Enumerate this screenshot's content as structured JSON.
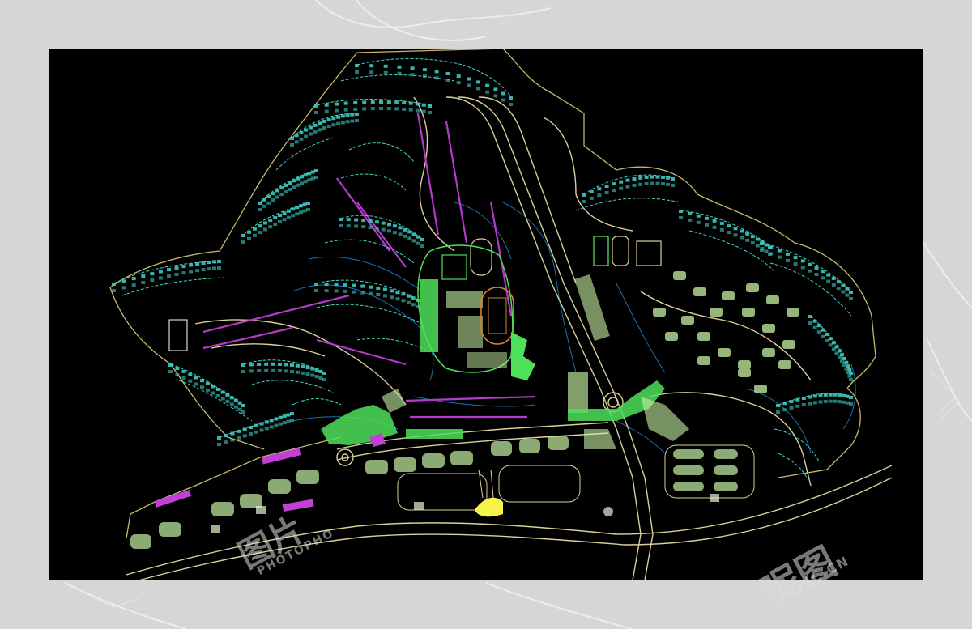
{
  "watermark": {
    "left_mark": "图片",
    "left_sub": "PHOTOPHO",
    "right_mark": "呢图",
    "right_sub": "NIPIC.CN"
  },
  "colors": {
    "background": "#000000",
    "outer_page": "#d6d6d6",
    "terrain_line": "#c9b96b",
    "contour_line": "#1e7fc4",
    "building_teal": "#45d6c8",
    "building_green": "#4fe05a",
    "pale_green": "#c8f2a5",
    "magenta": "#c23fd6",
    "road_line": "#d9d09a",
    "orange": "#d9852e",
    "yellow": "#f5f34a"
  },
  "map": {
    "description_layers": [
      "site-boundary",
      "roads",
      "contours",
      "residential-blocks",
      "sports-fields",
      "water-features"
    ]
  }
}
